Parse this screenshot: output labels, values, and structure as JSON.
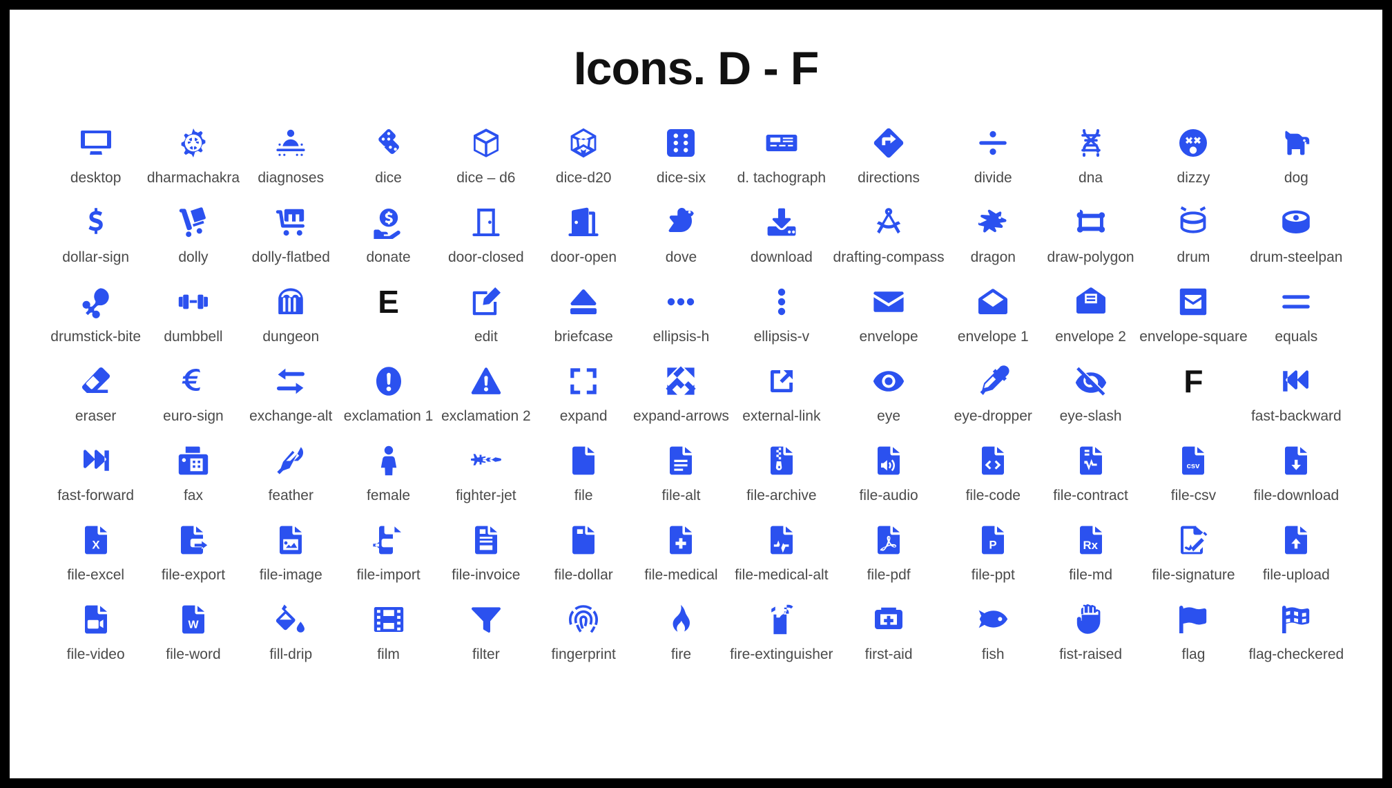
{
  "page": {
    "title": "Icons. D - F",
    "accent_color": "#2b51ef",
    "label_color": "#4a4a4a",
    "border_color": "#000000",
    "background_color": "#ffffff",
    "columns": 13,
    "rows": 7
  },
  "icons": [
    {
      "label": "desktop",
      "icon": "desktop-icon"
    },
    {
      "label": "dharmachakra",
      "icon": "dharmachakra-icon"
    },
    {
      "label": "diagnoses",
      "icon": "diagnoses-icon"
    },
    {
      "label": "dice",
      "icon": "dice-icon"
    },
    {
      "label": "dice – d6",
      "icon": "dice-d6-icon"
    },
    {
      "label": "dice-d20",
      "icon": "dice-d20-icon"
    },
    {
      "label": "dice-six",
      "icon": "dice-six-icon"
    },
    {
      "label": "d. tachograph",
      "icon": "digital-tachograph-icon"
    },
    {
      "label": "directions",
      "icon": "directions-icon"
    },
    {
      "label": "divide",
      "icon": "divide-icon"
    },
    {
      "label": "dna",
      "icon": "dna-icon"
    },
    {
      "label": "dizzy",
      "icon": "dizzy-icon"
    },
    {
      "label": "dog",
      "icon": "dog-icon"
    },
    {
      "label": "dollar-sign",
      "icon": "dollar-sign-icon"
    },
    {
      "label": "dolly",
      "icon": "dolly-icon"
    },
    {
      "label": "dolly-flatbed",
      "icon": "dolly-flatbed-icon"
    },
    {
      "label": "donate",
      "icon": "donate-icon"
    },
    {
      "label": "door-closed",
      "icon": "door-closed-icon"
    },
    {
      "label": "door-open",
      "icon": "door-open-icon"
    },
    {
      "label": "dove",
      "icon": "dove-icon"
    },
    {
      "label": "download",
      "icon": "download-icon"
    },
    {
      "label": "drafting-compass",
      "icon": "drafting-compass-icon"
    },
    {
      "label": "dragon",
      "icon": "dragon-icon"
    },
    {
      "label": "draw-polygon",
      "icon": "draw-polygon-icon"
    },
    {
      "label": "drum",
      "icon": "drum-icon"
    },
    {
      "label": "drum-steelpan",
      "icon": "drum-steelpan-icon"
    },
    {
      "label": "drumstick-bite",
      "icon": "drumstick-bite-icon"
    },
    {
      "label": "dumbbell",
      "icon": "dumbbell-icon"
    },
    {
      "label": "dungeon",
      "icon": "dungeon-icon"
    },
    {
      "label": "",
      "icon": "letter-e-divider",
      "letter": "E"
    },
    {
      "label": "edit",
      "icon": "edit-icon"
    },
    {
      "label": "briefcase",
      "icon": "eject-icon"
    },
    {
      "label": "ellipsis-h",
      "icon": "ellipsis-h-icon"
    },
    {
      "label": "ellipsis-v",
      "icon": "ellipsis-v-icon"
    },
    {
      "label": "envelope",
      "icon": "envelope-icon"
    },
    {
      "label": "envelope 1",
      "icon": "envelope-open-icon"
    },
    {
      "label": "envelope 2",
      "icon": "envelope-open-text-icon"
    },
    {
      "label": "envelope-square",
      "icon": "envelope-square-icon"
    },
    {
      "label": "equals",
      "icon": "equals-icon"
    },
    {
      "label": "eraser",
      "icon": "eraser-icon"
    },
    {
      "label": "euro-sign",
      "icon": "euro-sign-icon"
    },
    {
      "label": "exchange-alt",
      "icon": "exchange-alt-icon"
    },
    {
      "label": "exclamation 1",
      "icon": "exclamation-circle-icon"
    },
    {
      "label": "exclamation 2",
      "icon": "exclamation-triangle-icon"
    },
    {
      "label": "expand",
      "icon": "expand-icon"
    },
    {
      "label": "expand-arrows",
      "icon": "expand-arrows-icon"
    },
    {
      "label": "external-link",
      "icon": "external-link-icon"
    },
    {
      "label": "eye",
      "icon": "eye-icon"
    },
    {
      "label": "eye-dropper",
      "icon": "eye-dropper-icon"
    },
    {
      "label": "eye-slash",
      "icon": "eye-slash-icon"
    },
    {
      "label": "",
      "icon": "letter-f-divider",
      "letter": "F"
    },
    {
      "label": "fast-backward",
      "icon": "fast-backward-icon"
    },
    {
      "label": "fast-forward",
      "icon": "fast-forward-icon"
    },
    {
      "label": "fax",
      "icon": "fax-icon"
    },
    {
      "label": "feather",
      "icon": "feather-icon"
    },
    {
      "label": "female",
      "icon": "female-icon"
    },
    {
      "label": "fighter-jet",
      "icon": "fighter-jet-icon"
    },
    {
      "label": "file",
      "icon": "file-icon"
    },
    {
      "label": "file-alt",
      "icon": "file-alt-icon"
    },
    {
      "label": "file-archive",
      "icon": "file-archive-icon"
    },
    {
      "label": "file-audio",
      "icon": "file-audio-icon"
    },
    {
      "label": "file-code",
      "icon": "file-code-icon"
    },
    {
      "label": "file-contract",
      "icon": "file-contract-icon"
    },
    {
      "label": "file-csv",
      "icon": "file-csv-icon"
    },
    {
      "label": "file-download",
      "icon": "file-download-icon"
    },
    {
      "label": "file-excel",
      "icon": "file-excel-icon"
    },
    {
      "label": "file-export",
      "icon": "file-export-icon"
    },
    {
      "label": "file-image",
      "icon": "file-image-icon"
    },
    {
      "label": "file-import",
      "icon": "file-import-icon"
    },
    {
      "label": "file-invoice",
      "icon": "file-invoice-icon"
    },
    {
      "label": "file-dollar",
      "icon": "file-invoice-dollar-icon"
    },
    {
      "label": "file-medical",
      "icon": "file-medical-icon"
    },
    {
      "label": "file-medical-alt",
      "icon": "file-medical-alt-icon"
    },
    {
      "label": "file-pdf",
      "icon": "file-pdf-icon"
    },
    {
      "label": "file-ppt",
      "icon": "file-powerpoint-icon"
    },
    {
      "label": "file-md",
      "icon": "file-prescription-icon"
    },
    {
      "label": "file-signature",
      "icon": "file-signature-icon"
    },
    {
      "label": "file-upload",
      "icon": "file-upload-icon"
    },
    {
      "label": "file-video",
      "icon": "file-video-icon"
    },
    {
      "label": "file-word",
      "icon": "file-word-icon"
    },
    {
      "label": "fill-drip",
      "icon": "fill-drip-icon"
    },
    {
      "label": "film",
      "icon": "film-icon"
    },
    {
      "label": "filter",
      "icon": "filter-icon"
    },
    {
      "label": "fingerprint",
      "icon": "fingerprint-icon"
    },
    {
      "label": "fire",
      "icon": "fire-icon"
    },
    {
      "label": "fire-extinguisher",
      "icon": "fire-extinguisher-icon"
    },
    {
      "label": "first-aid",
      "icon": "first-aid-icon"
    },
    {
      "label": "fish",
      "icon": "fish-icon"
    },
    {
      "label": "fist-raised",
      "icon": "fist-raised-icon"
    },
    {
      "label": "flag",
      "icon": "flag-icon"
    },
    {
      "label": "flag-checkered",
      "icon": "flag-checkered-icon"
    }
  ]
}
